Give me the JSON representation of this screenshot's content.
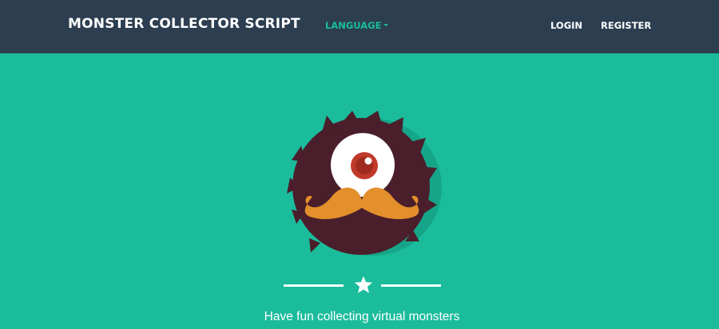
{
  "navbar": {
    "brand": "MONSTER COLLECTOR SCRIPT",
    "language_label": "LANGUAGE",
    "login_label": "LOGIN",
    "register_label": "REGISTER"
  },
  "hero": {
    "tagline": "Have fun collecting virtual monsters",
    "avatar_icon": "monster-avatar-icon",
    "divider_icon": "star-icon"
  },
  "colors": {
    "navbar_bg": "#2c3e50",
    "page_bg": "#1abc9c",
    "accent": "#1abc9c",
    "monster_fur": "#4a1f2b",
    "mustache": "#e38f2b",
    "eye_iris": "#c0392b"
  }
}
